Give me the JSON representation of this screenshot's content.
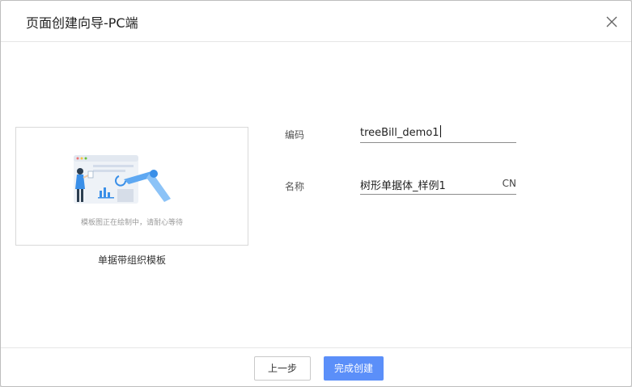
{
  "dialog": {
    "title": "页面创建向导-PC端"
  },
  "preview": {
    "caption": "模板图正在绘制中，请耐心等待",
    "template_name": "单据带组织模板"
  },
  "form": {
    "code": {
      "label": "编码",
      "value": "treeBill_demo1"
    },
    "name": {
      "label": "名称",
      "value": "树形单据体_样例1",
      "suffix": "CN"
    }
  },
  "footer": {
    "prev_label": "上一步",
    "finish_label": "完成创建"
  },
  "colors": {
    "primary": "#5b8ff9",
    "illustration_blue": "#3a8fe8"
  }
}
